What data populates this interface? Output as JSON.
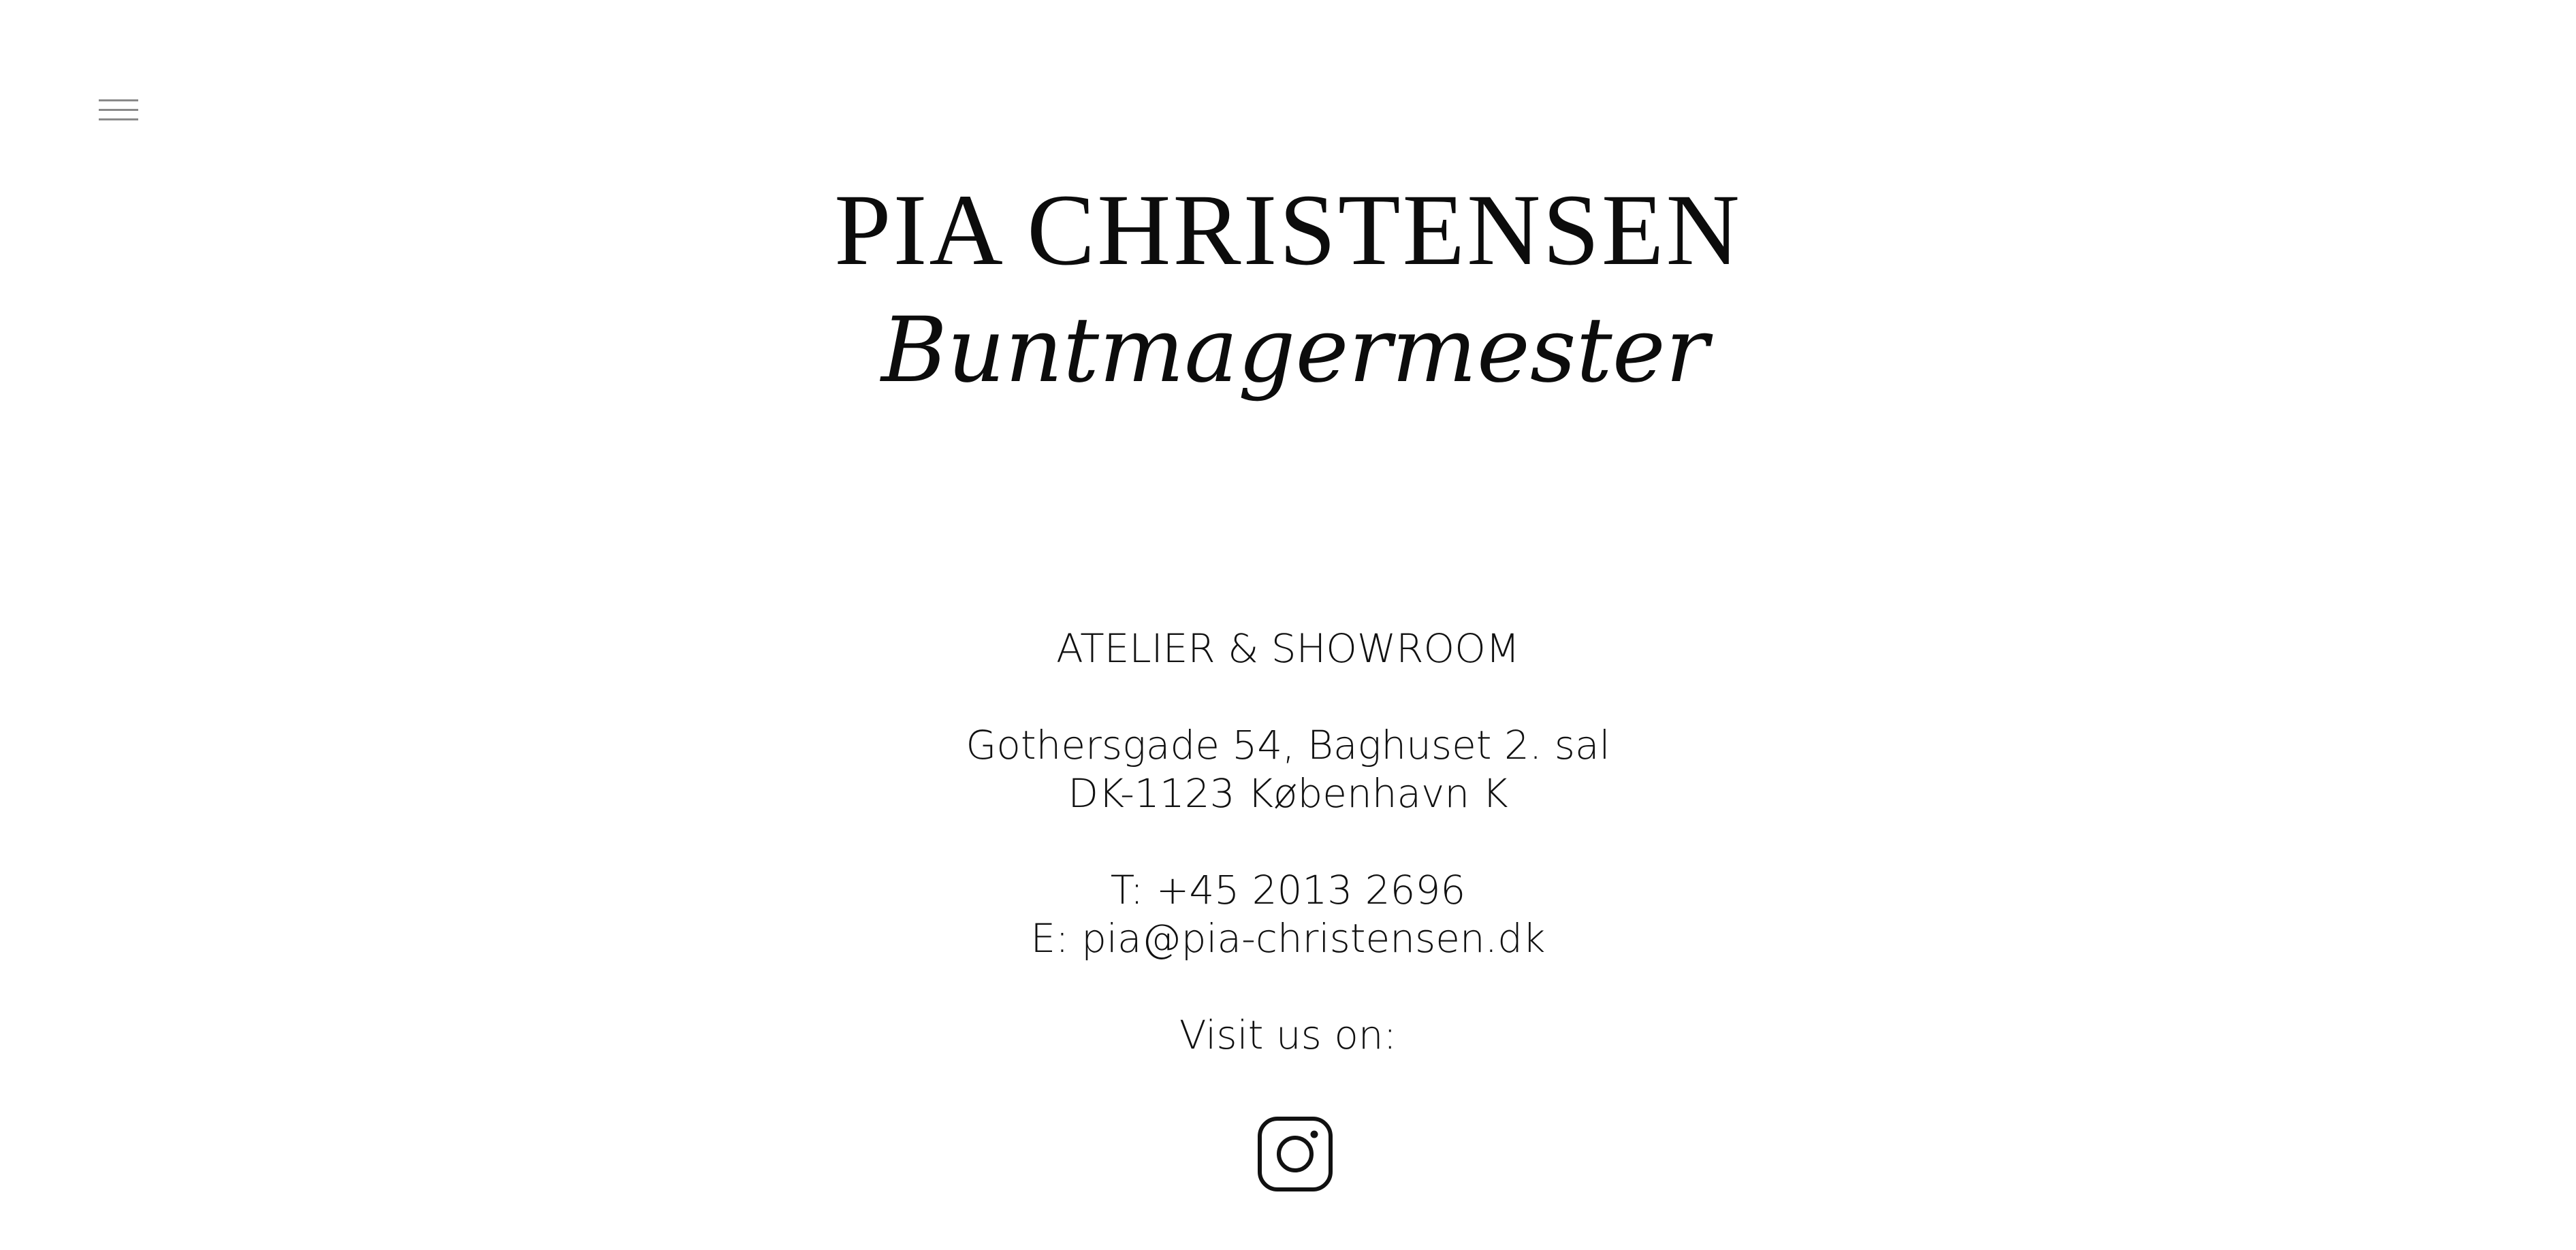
{
  "header": {
    "menu_icon": "hamburger-menu-icon"
  },
  "logo": {
    "name": "PIA CHRISTENSEN",
    "subtitle": "Buntmagermester"
  },
  "contact": {
    "heading": "ATELIER & SHOWROOM",
    "address_line1": "Gothersgade 54, Baghuset 2. sal",
    "address_line2": "DK-1123 København K",
    "phone": "T: +45 2013 2696",
    "email": "E: pia@pia-christensen.dk",
    "social_heading": "Visit us on:",
    "social_icon": "instagram-icon"
  },
  "colors": {
    "background": "#ffffff",
    "text": "#111111",
    "menu_icon": "#8a8a8a"
  }
}
